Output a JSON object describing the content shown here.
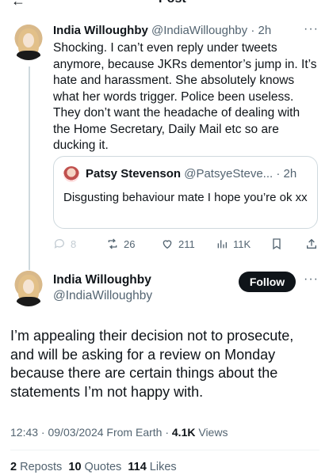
{
  "topbar": {
    "title": "Post"
  },
  "parent_post": {
    "author_name": "India Willoughby",
    "author_handle": "@IndiaWilloughby",
    "separator": " · ",
    "time": "2h",
    "text": "Shocking. I can’t even reply under tweets anymore, because JKRs dementor’s jump in. It’s hate and harassment. She absolutely knows what her words trigger. Police been useless. They don’t want the headache of dealing with the Home Secretary, Daily Mail etc so are ducking it.",
    "more_icon": "more-dots-icon",
    "quoted_post": {
      "author_name": "Patsy Stevenson",
      "author_handle": "@PatsyeSteve...",
      "separator": " · ",
      "time": "2h",
      "text": "Disgusting behaviour mate I hope you’re ok xx"
    },
    "actions": {
      "replies": "8",
      "reposts": "26",
      "likes": "211",
      "views": "11K"
    }
  },
  "main_post": {
    "author_name": "India Willoughby",
    "author_handle": "@IndiaWilloughby",
    "follow_label": "Follow",
    "text": "I’m appealing their decision not to prosecute, and will be asking for a review on Monday because there are certain things about the statements I’m not happy with.",
    "timestamp": "12:43 · 09/03/2024 From Earth · ",
    "views_count": "4.1K",
    "views_label": " Views",
    "stats": {
      "reposts_count": "2",
      "reposts_label": " Reposts",
      "quotes_count": "10",
      "quotes_label": " Quotes",
      "likes_count": "114",
      "likes_label": " Likes"
    }
  },
  "colors": {
    "text": "#0f1419",
    "secondary": "#536471",
    "border": "#cfd9de",
    "follow_bg": "#0f1419"
  }
}
